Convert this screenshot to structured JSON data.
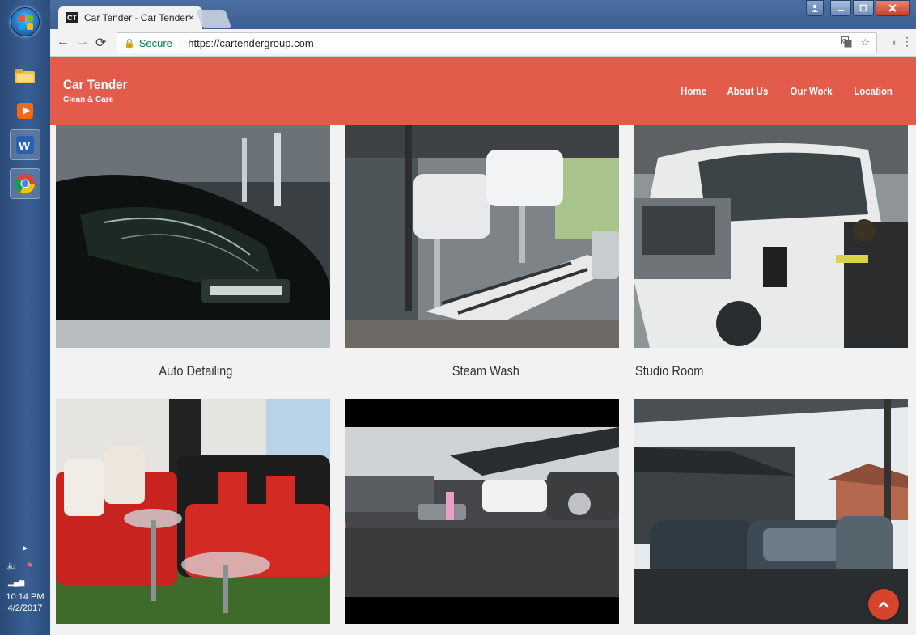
{
  "taskbar": {
    "clock_time": "10:14 PM",
    "clock_date": "4/2/2017"
  },
  "browser": {
    "tab_title": "Car Tender - Car Tender",
    "tab_close": "×",
    "secure_label": "Secure",
    "url": "https://cartendergroup.com"
  },
  "site": {
    "brand_title": "Car Tender",
    "brand_subtitle": "Clean & Care",
    "nav": [
      "Home",
      "About Us",
      "Our Work",
      "Location"
    ]
  },
  "gallery": {
    "captions": [
      "Auto Detailing",
      "Steam Wash",
      "Studio Room"
    ]
  },
  "colors": {
    "header": "#e35b4a",
    "scroll_top": "#d6452b"
  }
}
